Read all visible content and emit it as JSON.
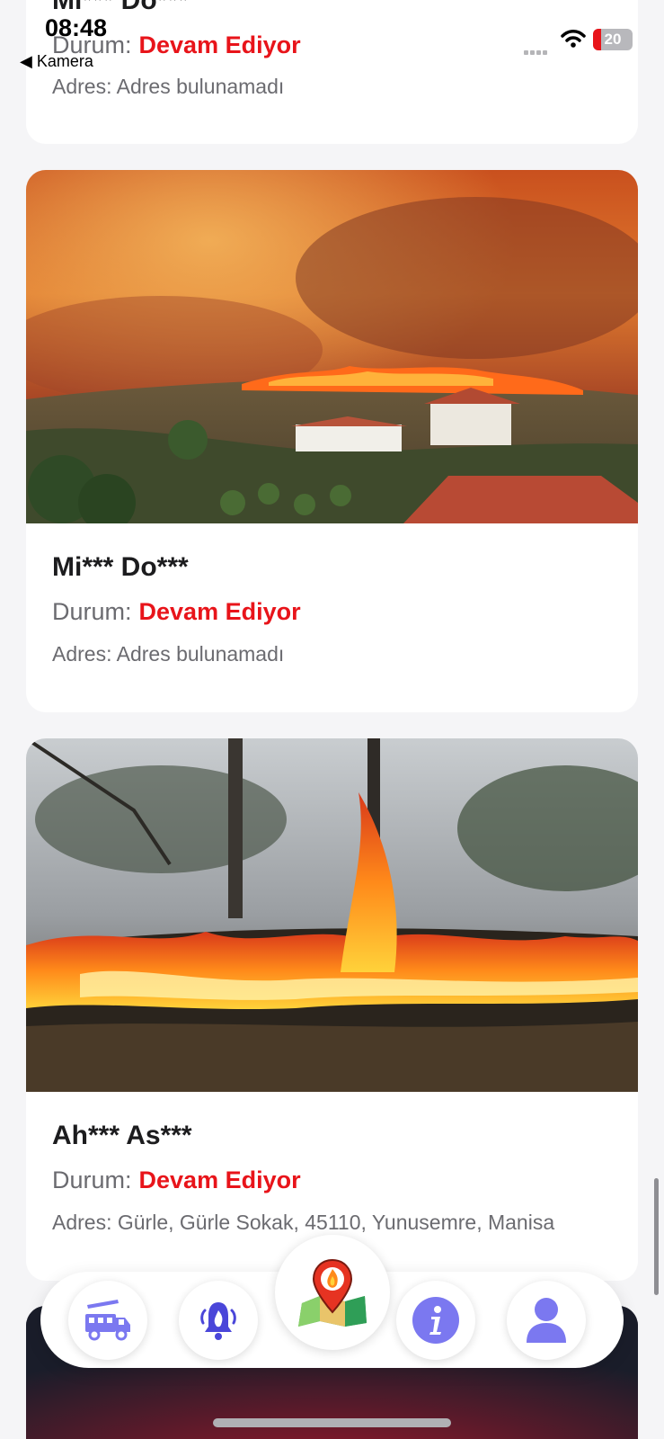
{
  "status_bar": {
    "time": "08:48",
    "back_label": "◀ Kamera",
    "battery": "20",
    "battery_level_percent": 20
  },
  "labels": {
    "status_prefix": "Durum:",
    "address_prefix": "Adres:"
  },
  "reports": [
    {
      "name": "Mi*** Do***",
      "status": "Devam Ediyor",
      "address": "Adres bulunamadı"
    },
    {
      "name": "Mi*** Do***",
      "status": "Devam Ediyor",
      "address": "Adres bulunamadı"
    },
    {
      "name": "Ah*** As***",
      "status": "Devam Ediyor",
      "address": "Gürle, Gürle Sokak, 45110, Yunusemre, Manisa"
    }
  ],
  "nav": {
    "items": [
      {
        "icon": "fire-truck-icon"
      },
      {
        "icon": "alarm-bell-fire-icon"
      },
      {
        "icon": "fire-map-pin-icon"
      },
      {
        "icon": "info-icon"
      },
      {
        "icon": "user-icon"
      }
    ],
    "accent": "#7b78f0"
  },
  "colors": {
    "status_active": "#e8141a",
    "background": "#f5f5f7"
  }
}
